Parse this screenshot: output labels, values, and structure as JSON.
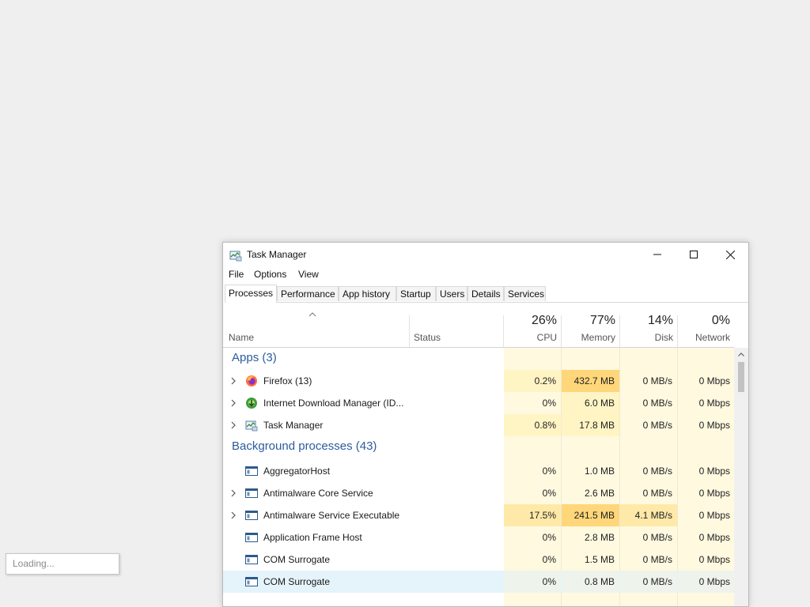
{
  "loading": {
    "text": "Loading..."
  },
  "window": {
    "title": "Task Manager",
    "menu": [
      "File",
      "Options",
      "View"
    ],
    "tabs": [
      "Processes",
      "Performance",
      "App history",
      "Startup",
      "Users",
      "Details",
      "Services"
    ],
    "active_tab": "Processes"
  },
  "header": {
    "name": "Name",
    "status": "Status",
    "cpu": {
      "pct": "26%",
      "label": "CPU"
    },
    "memory": {
      "pct": "77%",
      "label": "Memory"
    },
    "disk": {
      "pct": "14%",
      "label": "Disk"
    },
    "network": {
      "pct": "0%",
      "label": "Network"
    }
  },
  "groups": {
    "apps": "Apps (3)",
    "background": "Background processes (43)"
  },
  "apps": [
    {
      "name": "Firefox (13)",
      "icon": "firefox-icon",
      "expandable": true,
      "cpu": "0.2%",
      "memory": "432.7 MB",
      "disk": "0 MB/s",
      "network": "0 Mbps"
    },
    {
      "name": "Internet Download Manager (ID...",
      "icon": "idm-icon",
      "expandable": true,
      "cpu": "0%",
      "memory": "6.0 MB",
      "disk": "0 MB/s",
      "network": "0 Mbps"
    },
    {
      "name": "Task Manager",
      "icon": "task-manager-icon",
      "expandable": true,
      "cpu": "0.8%",
      "memory": "17.8 MB",
      "disk": "0 MB/s",
      "network": "0 Mbps"
    }
  ],
  "background": [
    {
      "name": "AggregatorHost",
      "icon": "window-icon",
      "expandable": false,
      "cpu": "0%",
      "memory": "1.0 MB",
      "disk": "0 MB/s",
      "network": "0 Mbps"
    },
    {
      "name": "Antimalware Core Service",
      "icon": "window-icon",
      "expandable": true,
      "cpu": "0%",
      "memory": "2.6 MB",
      "disk": "0 MB/s",
      "network": "0 Mbps"
    },
    {
      "name": "Antimalware Service Executable",
      "icon": "window-icon",
      "expandable": true,
      "cpu": "17.5%",
      "memory": "241.5 MB",
      "disk": "4.1 MB/s",
      "network": "0 Mbps"
    },
    {
      "name": "Application Frame Host",
      "icon": "window-icon",
      "expandable": false,
      "cpu": "0%",
      "memory": "2.8 MB",
      "disk": "0 MB/s",
      "network": "0 Mbps"
    },
    {
      "name": "COM Surrogate",
      "icon": "window-icon",
      "expandable": false,
      "cpu": "0%",
      "memory": "1.5 MB",
      "disk": "0 MB/s",
      "network": "0 Mbps"
    },
    {
      "name": "COM Surrogate",
      "icon": "window-icon",
      "expandable": false,
      "cpu": "0%",
      "memory": "0.8 MB",
      "disk": "0 MB/s",
      "network": "0 Mbps",
      "selected": true
    }
  ],
  "colors": {
    "heat_light": "#fff9e0",
    "heat_low": "#fff4c4",
    "heat_mid": "#ffe9a8",
    "heat_high": "#ffd67a",
    "group_title": "#2c5c9e",
    "selected_row": "#e5f3fb"
  }
}
